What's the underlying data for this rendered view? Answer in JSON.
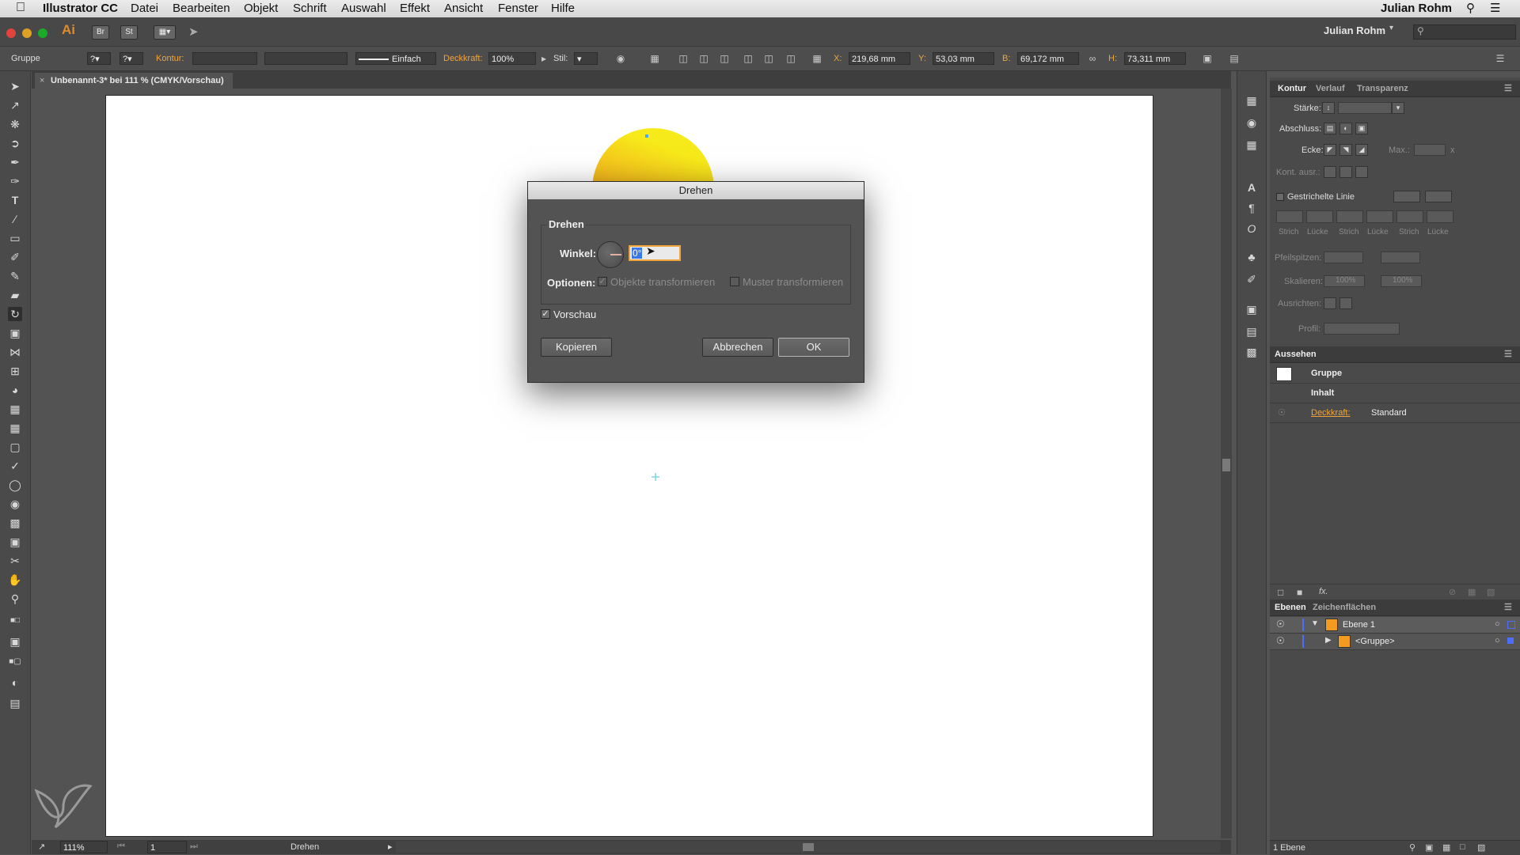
{
  "menubar": {
    "app_name": "Illustrator CC",
    "items": [
      "Datei",
      "Bearbeiten",
      "Objekt",
      "Schrift",
      "Auswahl",
      "Effekt",
      "Ansicht",
      "Fenster",
      "Hilfe"
    ],
    "user": "Julian Rohm"
  },
  "appbar": {
    "logo": "Ai",
    "bridge": "Br",
    "stock": "St",
    "workspace_user": "Julian Rohm"
  },
  "control": {
    "selection": "Gruppe",
    "kontur_label": "Kontur:",
    "stroke_style": "Einfach",
    "deckkraft_label": "Deckkraft:",
    "deckkraft_value": "100%",
    "stil_label": "Stil:",
    "x_label": "X:",
    "x_value": "219,68 mm",
    "y_label": "Y:",
    "y_value": "53,03 mm",
    "b_label": "B:",
    "b_value": "69,172 mm",
    "h_label": "H:",
    "h_value": "73,311 mm"
  },
  "document": {
    "tab_title": "Unbenannt-3* bei 111 % (CMYK/Vorschau)"
  },
  "status": {
    "zoom": "111%",
    "page": "1",
    "tool": "Drehen"
  },
  "dialog": {
    "title": "Drehen",
    "group_title": "Drehen",
    "angle_label": "Winkel:",
    "angle_value": "0°",
    "options_label": "Optionen:",
    "opt_objects": "Objekte transformieren",
    "opt_pattern": "Muster transformieren",
    "preview_label": "Vorschau",
    "btn_copy": "Kopieren",
    "btn_cancel": "Abbrechen",
    "btn_ok": "OK"
  },
  "stroke_panel": {
    "tabs": [
      "Kontur",
      "Verlauf",
      "Transparenz"
    ],
    "staerke": "Stärke:",
    "abschluss": "Abschluss:",
    "ecke": "Ecke:",
    "max": "Max.:",
    "x_suffix": "x",
    "kont_ausr": "Kont. ausr.:",
    "dashed_title": "Gestrichelte Linie",
    "dash_labels": [
      "Strich",
      "Lücke",
      "Strich",
      "Lücke",
      "Strich",
      "Lücke"
    ],
    "pfeilspitzen": "Pfeilspitzen:",
    "skalieren": "Skalieren:",
    "scale_values": [
      "100%",
      "100%"
    ],
    "ausrichten": "Ausrichten:",
    "profil": "Profil:"
  },
  "appearance_panel": {
    "tab": "Aussehen",
    "rows": {
      "group": "Gruppe",
      "content": "Inhalt",
      "opacity_label": "Deckkraft:",
      "opacity_value": "Standard"
    },
    "fx": "fx."
  },
  "layers_panel": {
    "tabs": [
      "Ebenen",
      "Zeichenflächen"
    ],
    "layer1": "Ebene 1",
    "group_item": "<Gruppe>",
    "footer": "1 Ebene"
  },
  "colors": {
    "accent_orange": "#f0a53c",
    "sun_top": "#f6e51a",
    "sun_bottom": "#f29b1f"
  }
}
